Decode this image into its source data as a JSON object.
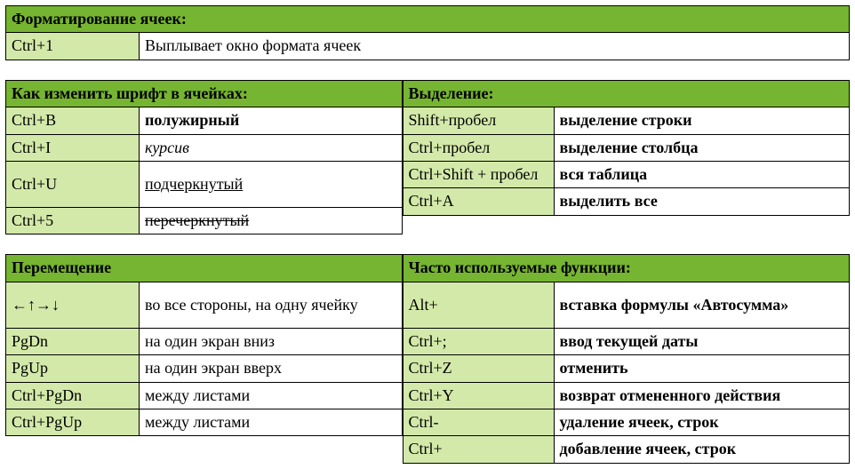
{
  "section1": {
    "title": "Форматирование ячеек:",
    "rows": [
      {
        "key": "Ctrl+1",
        "desc": "Выплывает окно формата ячеек"
      }
    ]
  },
  "section2": {
    "leftTitle": "Как изменить шрифт в ячейках:",
    "leftRows": [
      {
        "key": "Ctrl+B",
        "desc": "полужирный",
        "style": "bold"
      },
      {
        "key": "Ctrl+I",
        "desc": "курсив",
        "style": "italic"
      },
      {
        "key": "Ctrl+U",
        "desc": "подчеркнутый",
        "style": "underline"
      },
      {
        "key": "Ctrl+5",
        "desc": "перечеркнутый",
        "style": "strike"
      }
    ],
    "rightTitle": "Выделение:",
    "rightRows": [
      {
        "key": "Shift+пробел",
        "desc": "выделение строки"
      },
      {
        "key": "Ctrl+пробел",
        "desc": "выделение столбца"
      },
      {
        "key": "Ctrl+Shift + пробел",
        "desc": "вся таблица"
      },
      {
        "key": "Ctrl+A",
        "desc": "выделить все"
      }
    ]
  },
  "section3": {
    "leftTitle": "Перемещение",
    "leftRows": [
      {
        "key": "←↑→↓",
        "desc": "во все стороны, на одну ячейку"
      },
      {
        "key": "PgDn",
        "desc": "на один экран вниз"
      },
      {
        "key": "PgUp",
        "desc": "на один экран вверх"
      },
      {
        "key": "Ctrl+PgDn",
        "desc": "между листами"
      },
      {
        "key": "Ctrl+PgUp",
        "desc": "между листами"
      }
    ],
    "rightTitle": "Часто используемые функции:",
    "rightRows": [
      {
        "key": "Alt+",
        "desc": "вставка формулы «Автосумма»"
      },
      {
        "key": "Ctrl+;",
        "desc": "ввод текущей даты"
      },
      {
        "key": "Ctrl+Z",
        "desc": "отменить"
      },
      {
        "key": "Ctrl+Y",
        "desc": "возврат отмененного действия"
      },
      {
        "key": "Ctrl-",
        "desc": "удаление ячеек, строк"
      },
      {
        "key": "Ctrl+",
        "desc": "добавление ячеек, строк"
      }
    ]
  }
}
